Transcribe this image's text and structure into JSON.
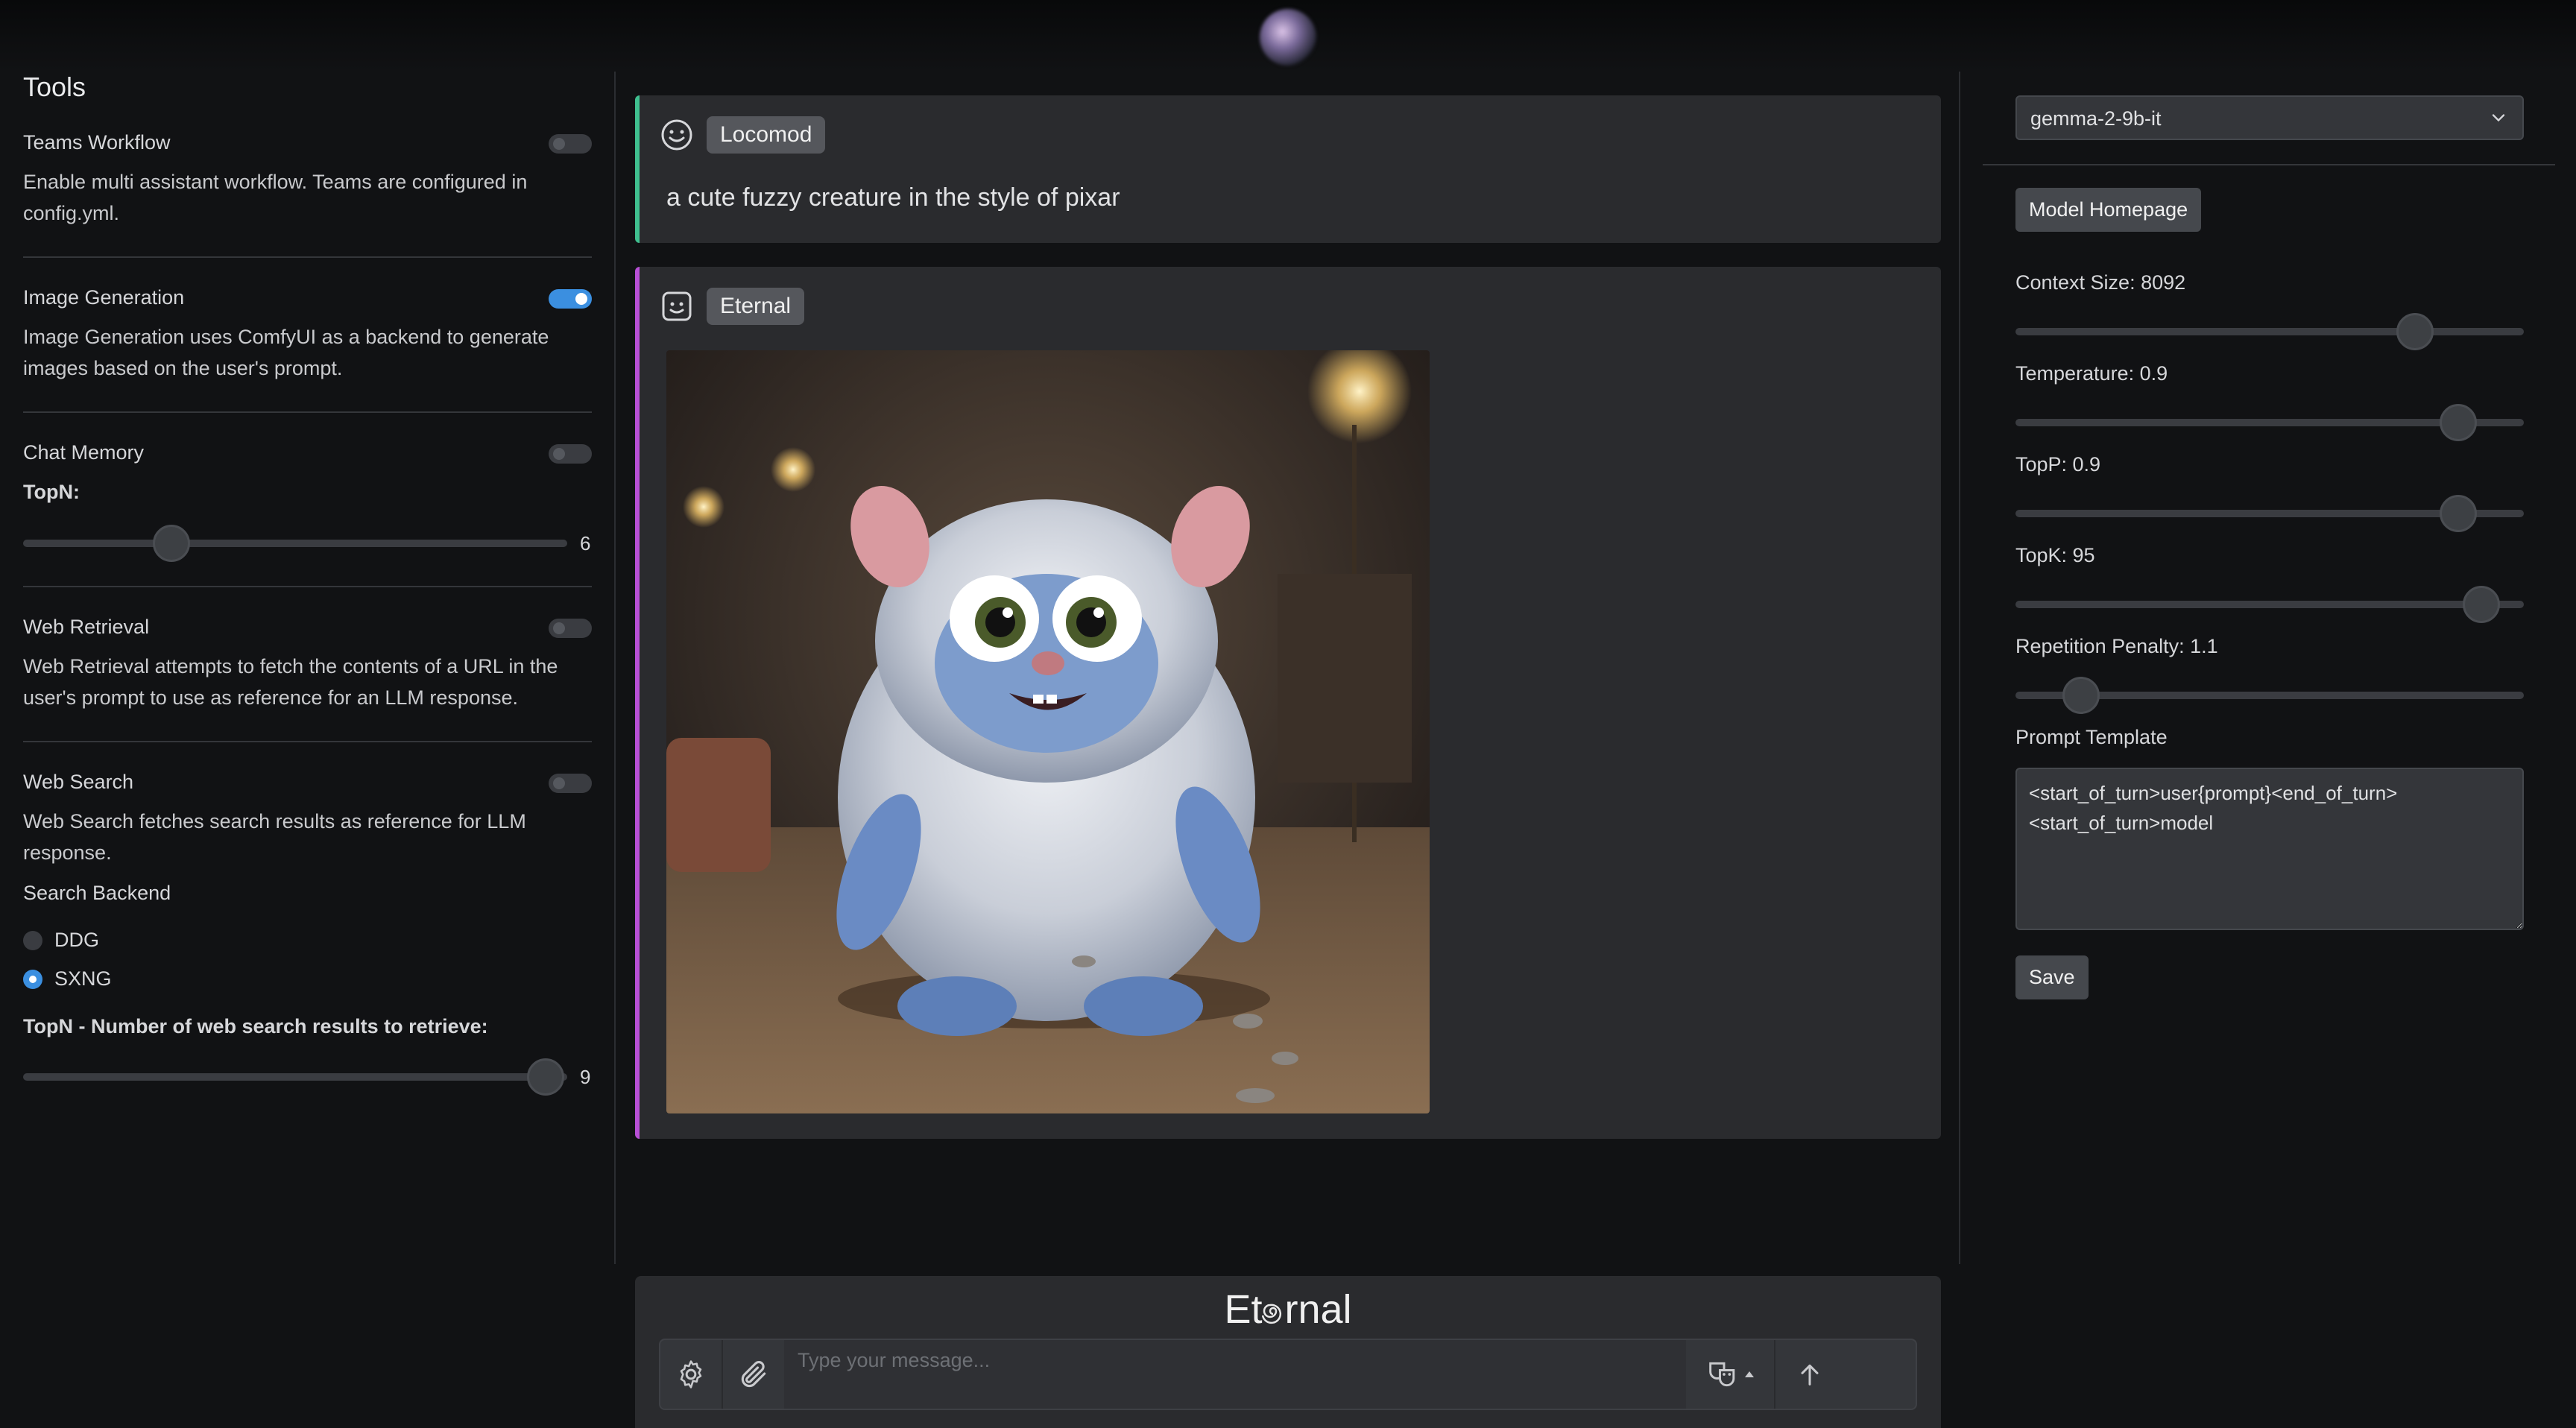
{
  "left": {
    "title": "Tools",
    "teams": {
      "title": "Teams Workflow",
      "enabled": false,
      "desc": "Enable multi assistant workflow. Teams are configured in config.yml."
    },
    "image_gen": {
      "title": "Image Generation",
      "enabled": true,
      "desc": "Image Generation uses ComfyUI as a backend to generate images based on the user's prompt."
    },
    "chat_memory": {
      "title": "Chat Memory",
      "enabled": false,
      "topn_label": "TopN:",
      "topn_value": "6"
    },
    "web_retrieval": {
      "title": "Web Retrieval",
      "enabled": false,
      "desc": "Web Retrieval attempts to fetch the contents of a URL in the user's prompt to use as reference for an LLM response."
    },
    "web_search": {
      "title": "Web Search",
      "enabled": false,
      "desc": "Web Search fetches search results as reference for LLM response.",
      "backend_label": "Search Backend",
      "backends": [
        "DDG",
        "SXNG"
      ],
      "selected_backend": "SXNG",
      "topn_label": "TopN - Number of web search results to retrieve:",
      "topn_value": "9"
    }
  },
  "chat": {
    "user_message": {
      "sender": "Locomod",
      "text": "a cute fuzzy creature in the style of pixar"
    },
    "bot_message": {
      "sender": "Eternal",
      "image_alt": "fuzzy blue pixar-style creature"
    }
  },
  "composer": {
    "brand_before": "Et",
    "brand_after": "rnal",
    "placeholder": "Type your message..."
  },
  "right": {
    "model": "gemma-2-9b-it",
    "homepage_button": "Model Homepage",
    "params": [
      {
        "label": "Context Size: 8092",
        "value": 8092,
        "min": 0,
        "max": 10000
      },
      {
        "label": "Temperature: 0.9",
        "value": 0.9,
        "min": 0,
        "max": 1
      },
      {
        "label": "TopP: 0.9",
        "value": 0.9,
        "min": 0,
        "max": 1
      },
      {
        "label": "TopK: 95",
        "value": 95,
        "min": 0,
        "max": 100
      },
      {
        "label": "Repetition Penalty: 1.1",
        "value": 1.1,
        "min": 1,
        "max": 2
      }
    ],
    "template_label": "Prompt Template",
    "template": "<start_of_turn>user{prompt}<end_of_turn>\n<start_of_turn>model",
    "save_button": "Save"
  },
  "colors": {
    "accent": "#3b8fe0",
    "user_border": "#3fbf8f",
    "bot_border": "#b84fd6"
  }
}
